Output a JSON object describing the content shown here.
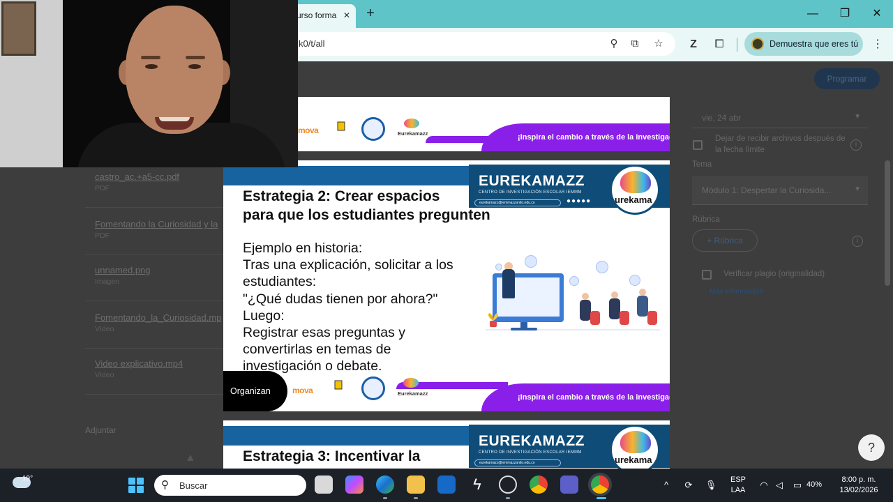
{
  "browser": {
    "tab_title": "urso forma",
    "url_fragment": "k0/t/all",
    "profile_label": "Demuestra que eres tú",
    "icons": [
      "zoom-icon",
      "install-icon",
      "star-icon",
      "zotero-icon",
      "extensions-icon",
      "more-icon"
    ]
  },
  "page": {
    "files": [
      {
        "name": "castro_ac.+a5-cc.pdf",
        "type": "PDF"
      },
      {
        "name": "Fomentando la Curiosidad y la",
        "type": "PDF"
      },
      {
        "name": "unnamed.png",
        "type": "Imagen"
      },
      {
        "name": "Fomentando_la_Curiosidad.mp",
        "type": "Vídeo"
      },
      {
        "name": "Video explicativo.mp4",
        "type": "Vídeo"
      }
    ],
    "adjuntar_label": "Adjuntar",
    "right_panel": {
      "programar_label": "Programar",
      "date_value": "vie, 24 abr",
      "stop_receiving_label": "Dejar de recibir archivos después de la fecha límite",
      "tema_label": "Tema",
      "tema_value": "Módulo 1: Despertar la Curiosida...",
      "rubrica_label": "Rúbrica",
      "rubrica_button": "+  Rúbrica",
      "plagio_label": "Verificar plagio (originalidad)",
      "more_info_link": "Más información"
    }
  },
  "slide_top": {
    "banner_text": "¡Inspira el cambio a través de la investigación!",
    "logo_mova": "mova",
    "logo_eureka": "Eurekamazz"
  },
  "slide_main": {
    "brand_title": "EUREKAMAZZ",
    "brand_subtitle": "CENTRO DE INVESTIGACIÓN ESCOLAR IEMMM",
    "brand_email": "eurekamazz@iemmazzanito.edu.co",
    "brand_dots": "●●●●●",
    "circle_text": "urekama",
    "title_lines": [
      "Estrategia 2: Crear espacios",
      "para que los estudiantes pregunten"
    ],
    "body_lines": [
      "Ejemplo en historia:",
      "Tras una explicación, solicitar a los",
      "estudiantes:",
      "\"¿Qué dudas tienen por ahora?\"",
      "Luego:",
      "Registrar esas preguntas y",
      "convertirlas en temas de",
      "investigación o debate."
    ],
    "organizan_label": "Organizan",
    "logo_mova": "mova",
    "logo_eureka": "Eurekamazz",
    "banner_text": "¡Inspira el cambio a través de la investigación!"
  },
  "slide_next": {
    "brand_title": "EUREKAMAZZ",
    "brand_subtitle": "CENTRO DE INVESTIGACIÓN ESCOLAR IEMMM",
    "brand_email": "eurekamazz@iemmazzanito.edu.co",
    "circle_text": "urekama",
    "title_line": "Estrategia 3: Incentivar la"
  },
  "taskbar": {
    "weather_temp": "19°",
    "search_placeholder": "Buscar",
    "lang_line1": "ESP",
    "lang_line2": "LAA",
    "battery": "40%",
    "time": "8:00 p. m.",
    "date": "13/02/2026"
  },
  "colors": {
    "accent_teal": "#5fc4c8",
    "slide_purple": "#8b1fea",
    "slide_blue": "#0f4d78"
  }
}
